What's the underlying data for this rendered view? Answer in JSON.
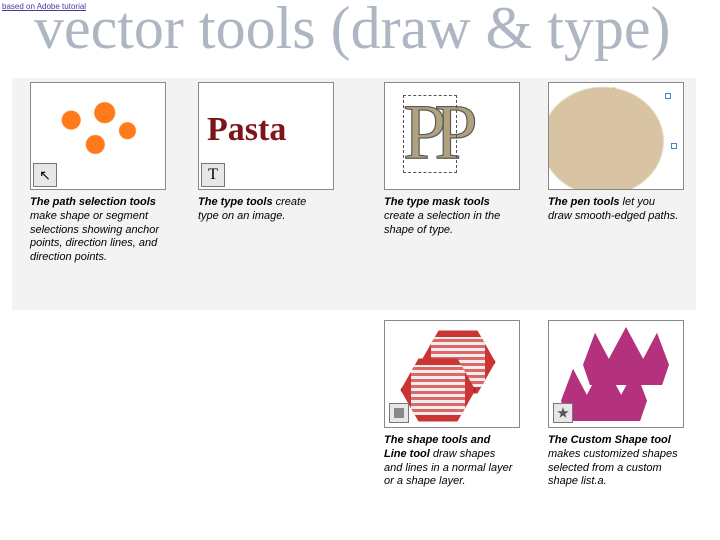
{
  "topnote": "based on Adobe tutorial",
  "title": "vector tools (draw & type)",
  "items": [
    {
      "bold": "The path selection tools",
      "rest": " make shape or segment selections showing anchor points, direction lines, and direction points."
    },
    {
      "bold": "The type tools",
      "rest": " create type on an image."
    },
    {
      "bold": "The type mask tools",
      "rest": " create a selection in the shape of type."
    },
    {
      "bold": "The pen tools",
      "rest": " let you draw smooth-edged paths."
    },
    {
      "bold": "The shape tools and Line tool",
      "rest": " draw shapes and lines in a normal layer or a shape layer."
    },
    {
      "bold": "The Custom Shape tool",
      "rest": " makes customized shapes selected from a custom shape list.a."
    }
  ],
  "thumb_labels": {
    "pasta": "Pasta",
    "arrow_glyph": "↖",
    "type_glyph": "T",
    "mask_glyph": "PP"
  }
}
